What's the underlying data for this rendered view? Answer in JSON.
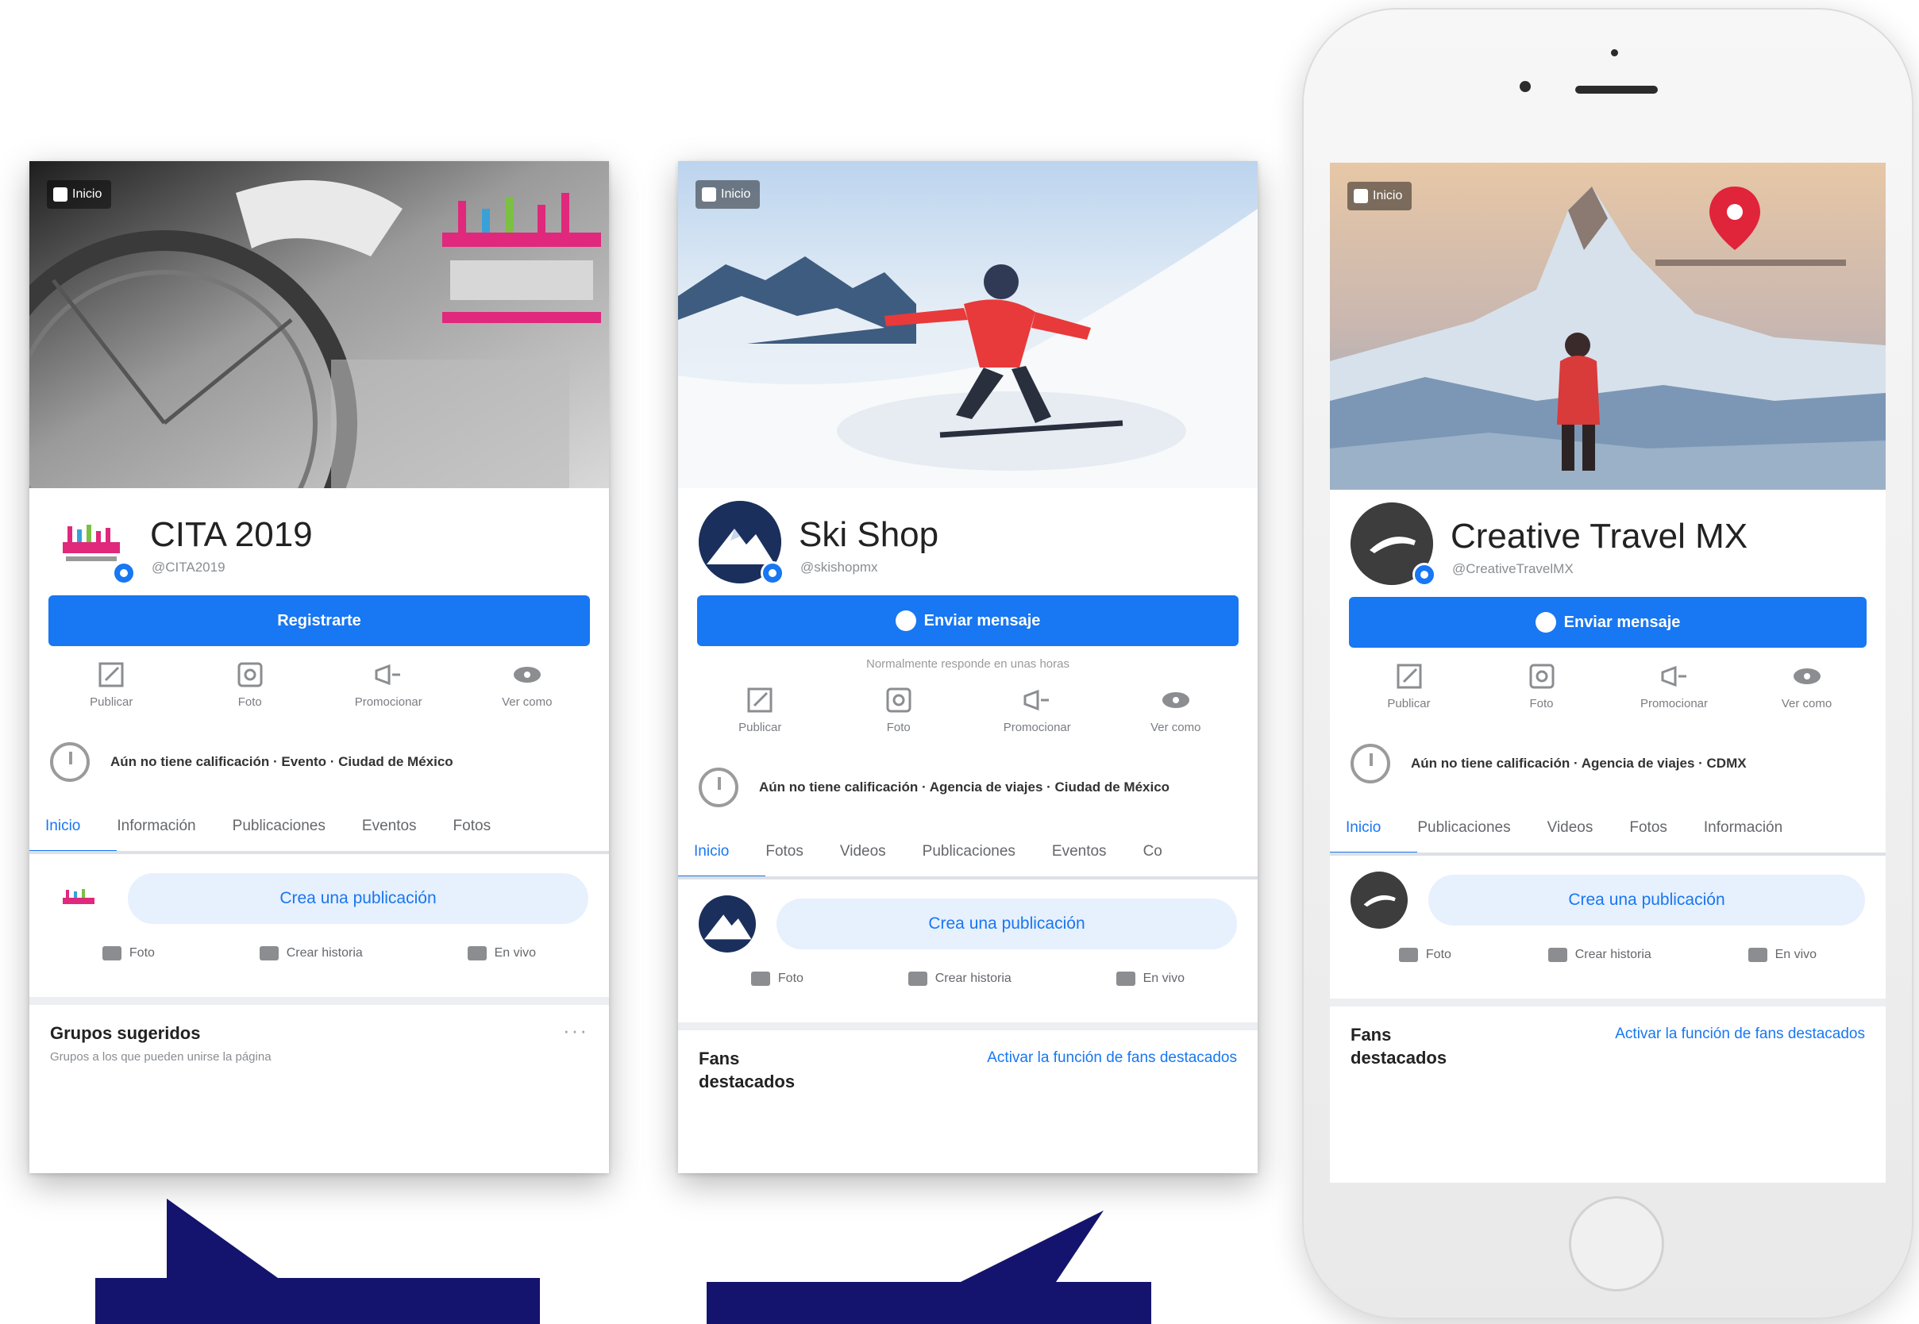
{
  "panels": [
    {
      "cover_badge": "Inicio",
      "name": "CITA 2019",
      "handle": "@CITA2019",
      "primary_button": "Registrarte",
      "sub_note": "",
      "actions": [
        "Publicar",
        "Foto",
        "Promocionar",
        "Ver como"
      ],
      "info_text": "Aún no tiene calificación · Evento · Ciudad de México",
      "tabs": [
        "Inicio",
        "Información",
        "Publicaciones",
        "Eventos",
        "Fotos"
      ],
      "composer_placeholder": "Crea una publicación",
      "composer_actions": [
        "Foto",
        "Crear historia",
        "En vivo"
      ],
      "bottom_title": "Grupos sugeridos",
      "bottom_sub": "Grupos a los que pueden unirse la página",
      "bottom_link": "",
      "colors": {
        "cover_theme": "#6b6b6b",
        "logo_pink": "#e0287c"
      }
    },
    {
      "cover_badge": "Inicio",
      "name": "Ski Shop",
      "handle": "@skishopmx",
      "primary_button": "Enviar mensaje",
      "sub_note": "Normalmente responde en unas horas",
      "actions": [
        "Publicar",
        "Foto",
        "Promocionar",
        "Ver como"
      ],
      "info_text": "Aún no tiene calificación · Agencia de viajes · Ciudad de México",
      "tabs": [
        "Inicio",
        "Fotos",
        "Videos",
        "Publicaciones",
        "Eventos",
        "Co"
      ],
      "composer_placeholder": "Crea una publicación",
      "composer_actions": [
        "Foto",
        "Crear historia",
        "En vivo"
      ],
      "bottom_title": "Fans destacados",
      "bottom_sub": "",
      "bottom_link": "Activar la función de fans destacados",
      "colors": {
        "cover_theme": "#cfe0f2",
        "jacket": "#e83a3a"
      }
    },
    {
      "cover_badge": "Inicio",
      "name": "Creative Travel MX",
      "handle": "@CreativeTravelMX",
      "primary_button": "Enviar mensaje",
      "sub_note": "",
      "actions": [
        "Publicar",
        "Foto",
        "Promocionar",
        "Ver como"
      ],
      "info_text": "Aún no tiene calificación · Agencia de viajes · CDMX",
      "tabs": [
        "Inicio",
        "Publicaciones",
        "Videos",
        "Fotos",
        "Información"
      ],
      "composer_placeholder": "Crea una publicación",
      "composer_actions": [
        "Foto",
        "Crear historia",
        "En vivo"
      ],
      "bottom_title": "Fans destacados",
      "bottom_sub": "",
      "bottom_link": "Activar la función de fans destacados",
      "colors": {
        "cover_theme": "#b9cde0",
        "pin": "#e0243a"
      }
    }
  ],
  "colors": {
    "facebook_blue": "#1877f2",
    "arrow_navy": "#14146e"
  }
}
